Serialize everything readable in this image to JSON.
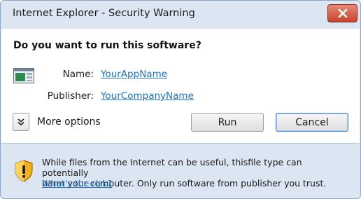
{
  "window": {
    "title": "Internet Explorer - Security Warning",
    "close_icon": "close-icon"
  },
  "main": {
    "headline": "Do you want to run this software?",
    "app_icon": "application-icon",
    "name_label": "Name:",
    "name_value": "YourAppName",
    "publisher_label": "Publisher:",
    "publisher_value": "YourCompanyName",
    "more_options_label": "More options",
    "expander_icon": "double-chevron-down-icon",
    "run_label": "Run",
    "cancel_label": "Cancel"
  },
  "footer": {
    "shield_icon": "warning-shield-icon",
    "warning_line1": "While files from the Internet can be useful, thisfile type can potentially",
    "warning_line2": "harm your computer. Only run software from publisher you trust.",
    "risk_link": "What's the risk?"
  },
  "colors": {
    "link": "#1a72c9",
    "close_button": "#c8432a",
    "frame": "#dbe6f2"
  }
}
